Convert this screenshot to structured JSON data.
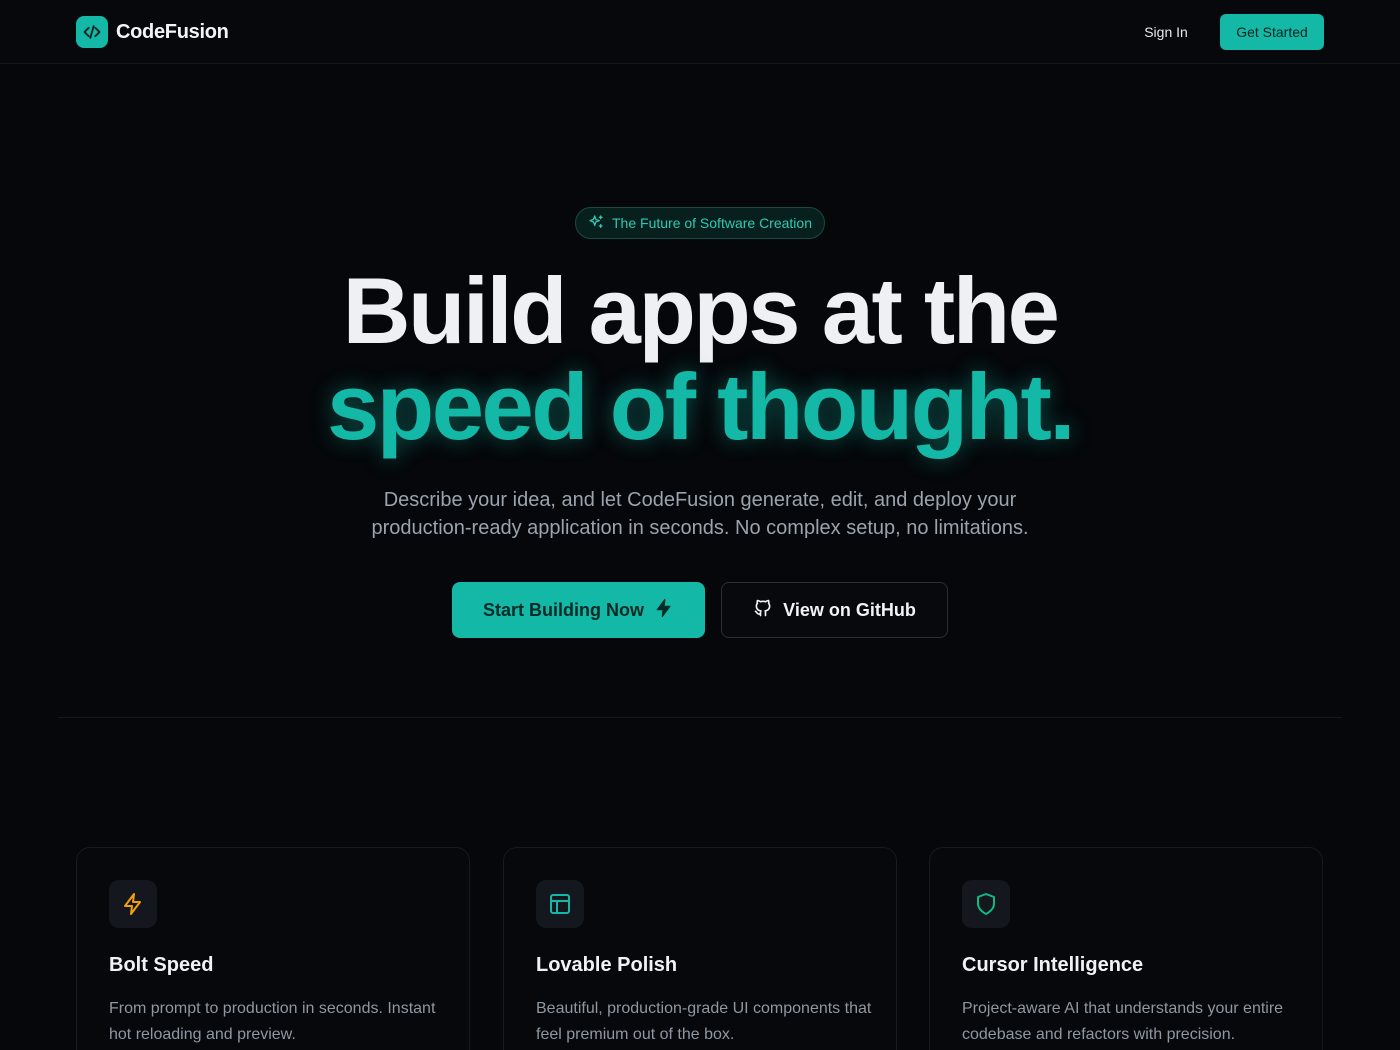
{
  "header": {
    "brand": "CodeFusion",
    "sign_in": "Sign In",
    "get_started": "Get Started"
  },
  "hero": {
    "badge": "The Future of Software Creation",
    "title_line1": "Build apps at the",
    "title_line2": "speed of thought.",
    "subtitle_line1": "Describe your idea, and let CodeFusion generate, edit, and deploy your",
    "subtitle_line2": "production-ready application in seconds. No complex setup, no limitations.",
    "primary_cta": "Start Building Now",
    "secondary_cta": "View on GitHub"
  },
  "features": [
    {
      "icon": "bolt-icon",
      "title": "Bolt Speed",
      "description": "From prompt to production in seconds. Instant hot reloading and preview."
    },
    {
      "icon": "layout-icon",
      "title": "Lovable Polish",
      "description": "Beautiful, production-grade UI components that feel premium out of the box."
    },
    {
      "icon": "shield-icon",
      "title": "Cursor Intelligence",
      "description": "Project-aware AI that understands your entire codebase and refactors with precision."
    }
  ],
  "colors": {
    "accent": "#14b8a6",
    "background": "#05070a",
    "bolt_icon": "#f59e0b",
    "shield_icon": "#10b981"
  }
}
